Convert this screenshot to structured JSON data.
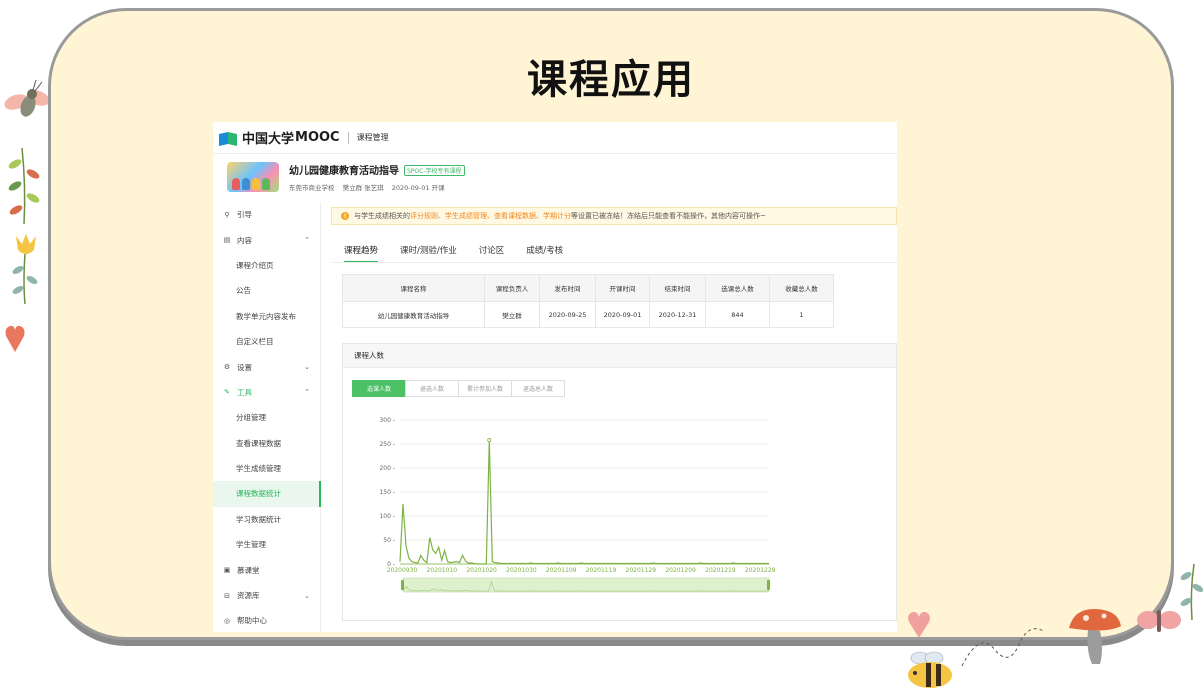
{
  "slide": {
    "title": "课程应用"
  },
  "header": {
    "logo_cn": "中国大学",
    "logo_en": "MOOC",
    "breadcrumb": "课程管理"
  },
  "course": {
    "name": "幼儿园健康教育活动指导",
    "tag": "SPOC-学校专有课程",
    "school": "东莞市商业学校",
    "teachers": "樊立群 张艺琪",
    "start": "2020-09-01 开课"
  },
  "sidebar": {
    "items": [
      {
        "label": "引导",
        "icon": "guide-icon",
        "sub": false
      },
      {
        "label": "内容",
        "icon": "document-icon",
        "sub": false,
        "chevron": "up"
      },
      {
        "label": "课程介绍页",
        "sub": true
      },
      {
        "label": "公告",
        "sub": true
      },
      {
        "label": "教学单元内容发布",
        "sub": true
      },
      {
        "label": "自定义栏目",
        "sub": true
      },
      {
        "label": "设置",
        "icon": "gear-icon",
        "sub": false,
        "chevron": "down"
      },
      {
        "label": "工具",
        "icon": "tools-icon",
        "sub": false,
        "chevron": "up"
      },
      {
        "label": "分组管理",
        "sub": true
      },
      {
        "label": "查看课程数据",
        "sub": true
      },
      {
        "label": "学生成绩管理",
        "sub": true
      },
      {
        "label": "课程数据统计",
        "sub": true,
        "active": true
      },
      {
        "label": "学习数据统计",
        "sub": true
      },
      {
        "label": "学生管理",
        "sub": true
      },
      {
        "label": "慕课堂",
        "icon": "classroom-icon",
        "sub": false
      },
      {
        "label": "资源库",
        "icon": "database-icon",
        "sub": false,
        "chevron": "down"
      },
      {
        "label": "帮助中心",
        "icon": "help-icon",
        "sub": false
      }
    ]
  },
  "notice": {
    "prefix": "与学生成绩相关的",
    "highlight": "评分规则、学生成绩管理、查看课程数据、学期计分",
    "suffix": "等设置已被冻结！冻结后只能查看不能操作，其他内容可操作~"
  },
  "tabs": [
    "课程趋势",
    "课时/测验/作业",
    "讨论区",
    "成绩/考核"
  ],
  "table": {
    "headers": [
      "课程名称",
      "课程负责人",
      "发布时间",
      "开课时间",
      "结束时间",
      "选课总人数",
      "收藏总人数"
    ],
    "row": [
      "幼儿园健康教育活动指导",
      "樊立群",
      "2020-09-25",
      "2020-09-01",
      "2020-12-31",
      "844",
      "1"
    ]
  },
  "chart_panel": {
    "title": "课程人数",
    "buttons": [
      "选课人数",
      "退选人数",
      "累计参加人数",
      "退选总人数"
    ]
  },
  "chart_data": {
    "type": "line",
    "series": [
      {
        "name": "选课人数",
        "color": "#7cb342",
        "values": [
          5,
          125,
          38,
          12,
          5,
          3,
          2,
          18,
          8,
          3,
          55,
          30,
          22,
          35,
          8,
          28,
          5,
          3,
          4,
          5,
          3,
          18,
          6,
          2,
          2,
          1,
          0,
          0,
          0,
          0,
          258,
          5,
          3,
          2,
          1,
          1,
          1,
          1,
          1,
          1,
          1,
          1,
          1,
          1,
          2,
          1,
          1,
          1,
          1,
          1,
          1,
          1,
          1,
          2,
          1,
          1,
          1,
          1,
          1,
          1,
          1,
          2,
          1,
          1,
          1,
          1,
          1,
          1,
          1,
          1,
          1,
          1,
          1,
          1,
          1,
          1,
          1,
          1,
          1,
          1,
          1,
          1,
          1,
          1,
          1,
          2,
          1,
          1,
          1,
          1,
          1,
          1,
          1,
          1,
          1,
          1,
          1,
          1,
          1,
          1,
          1,
          2,
          1,
          1,
          1,
          1,
          1,
          1,
          1,
          1,
          1,
          1,
          2,
          1,
          1,
          1,
          1,
          1,
          1,
          1,
          1,
          1,
          1,
          1,
          1
        ]
      }
    ],
    "categories": [
      "20200930",
      "20201010",
      "20201020",
      "20201030",
      "20201109",
      "20201119",
      "20201129",
      "20201209",
      "20201219",
      "20201229"
    ],
    "yticks": [
      300,
      250,
      200,
      150,
      100,
      50,
      0
    ],
    "ylim": [
      0,
      300
    ],
    "grid": true
  }
}
